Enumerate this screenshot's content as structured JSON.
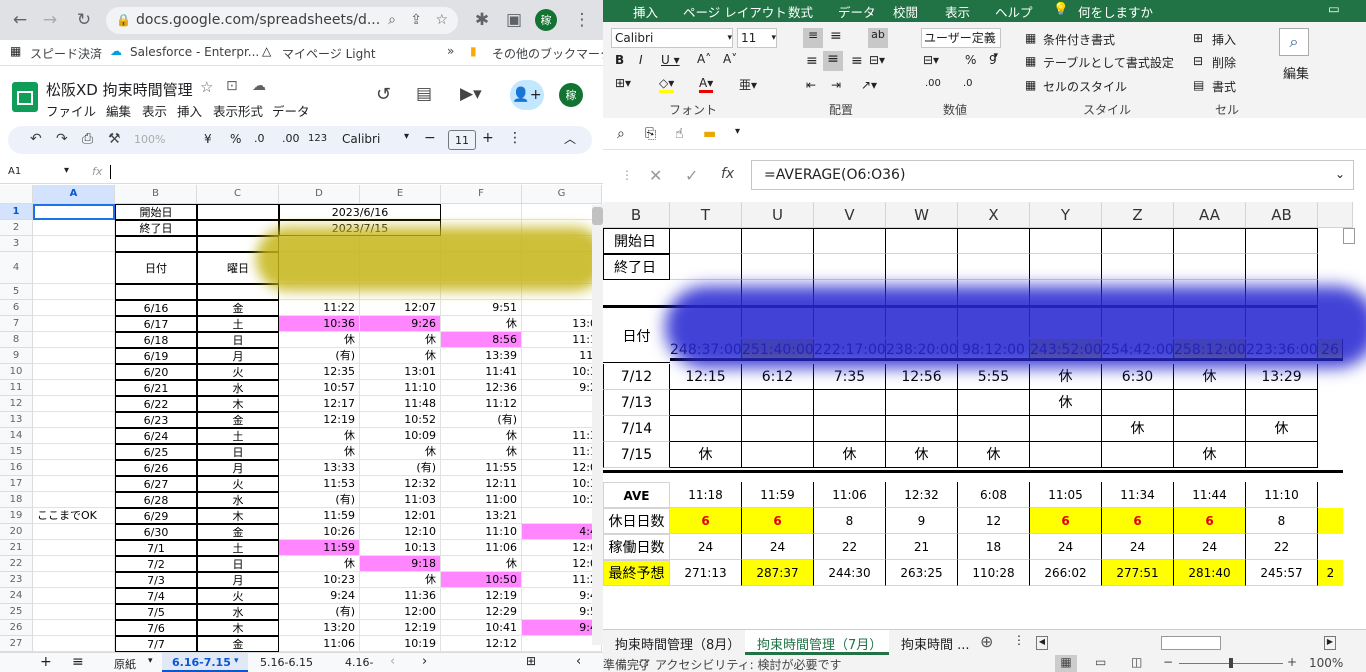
{
  "chrome": {
    "url": "docs.google.com/spreadsheets/d...",
    "avatar": "稼",
    "bookmarks": [
      "スピード決済",
      "Salesforce - Enterpr...",
      "マイページ Light",
      "»",
      "その他のブックマーク"
    ]
  },
  "gs": {
    "title": "松阪XD 拘束時間管理",
    "menu": [
      "ファイル",
      "編集",
      "表示",
      "挿入",
      "表示形式",
      "データ"
    ],
    "avatar": "稼",
    "toolbar": {
      "zoom": "100%",
      "currency": "¥",
      "percent": "%",
      "dec_less": ".0",
      "dec_more": ".00",
      "fmt": "123",
      "font": "Calibri",
      "size": "11"
    },
    "namebox": "A1",
    "fx": "fx",
    "col_headers": [
      "A",
      "B",
      "C",
      "D",
      "E",
      "F",
      "G"
    ],
    "rows": [
      {
        "n": "1",
        "A": "",
        "B": "開始日",
        "C": "",
        "D": "2023/6/16",
        "E": "",
        "F": "",
        "G": ""
      },
      {
        "n": "2",
        "A": "",
        "B": "終了日",
        "C": "",
        "D": "2023/7/15",
        "E": "",
        "F": "",
        "G": ""
      },
      {
        "n": "3",
        "A": "",
        "B": "",
        "C": "",
        "D": "",
        "E": "",
        "F": "",
        "G": ""
      },
      {
        "n": "4",
        "A": "",
        "B": "日付",
        "C": "曜日",
        "D": "",
        "E": "",
        "F": "",
        "G": ""
      },
      {
        "n": "5",
        "A": "",
        "B": "",
        "C": "",
        "D": "",
        "E": "",
        "F": "",
        "G": ""
      },
      {
        "n": "6",
        "A": "",
        "B": "6/16",
        "C": "金",
        "D": "11:22",
        "E": "12:07",
        "F": "9:51",
        "G": "",
        "pk": []
      },
      {
        "n": "7",
        "A": "",
        "B": "6/17",
        "C": "土",
        "D": "10:36",
        "E": "9:26",
        "F": "休",
        "G": "13:0",
        "pk": [
          "D",
          "E"
        ]
      },
      {
        "n": "8",
        "A": "",
        "B": "6/18",
        "C": "日",
        "D": "休",
        "E": "休",
        "F": "8:56",
        "G": "11:1",
        "pk": [
          "F"
        ]
      },
      {
        "n": "9",
        "A": "",
        "B": "6/19",
        "C": "月",
        "D": "(有)",
        "E": "休",
        "F": "13:39",
        "G": "11:",
        "pk": []
      },
      {
        "n": "10",
        "A": "",
        "B": "6/20",
        "C": "火",
        "D": "12:35",
        "E": "13:01",
        "F": "11:41",
        "G": "10:3",
        "pk": []
      },
      {
        "n": "11",
        "A": "",
        "B": "6/21",
        "C": "水",
        "D": "10:57",
        "E": "11:10",
        "F": "12:36",
        "G": "9:2",
        "pk": []
      },
      {
        "n": "12",
        "A": "",
        "B": "6/22",
        "C": "木",
        "D": "12:17",
        "E": "11:48",
        "F": "11:12",
        "G": "",
        "pk": []
      },
      {
        "n": "13",
        "A": "",
        "B": "6/23",
        "C": "金",
        "D": "12:19",
        "E": "10:52",
        "F": "(有)",
        "G": "",
        "pk": []
      },
      {
        "n": "14",
        "A": "",
        "B": "6/24",
        "C": "土",
        "D": "休",
        "E": "10:09",
        "F": "休",
        "G": "11:3",
        "pk": []
      },
      {
        "n": "15",
        "A": "",
        "B": "6/25",
        "C": "日",
        "D": "休",
        "E": "休",
        "F": "休",
        "G": "11:1",
        "pk": []
      },
      {
        "n": "16",
        "A": "",
        "B": "6/26",
        "C": "月",
        "D": "13:33",
        "E": "(有)",
        "F": "11:55",
        "G": "12:0",
        "pk": []
      },
      {
        "n": "17",
        "A": "",
        "B": "6/27",
        "C": "火",
        "D": "11:53",
        "E": "12:32",
        "F": "12:11",
        "G": "10:3",
        "pk": []
      },
      {
        "n": "18",
        "A": "",
        "B": "6/28",
        "C": "水",
        "D": "(有)",
        "E": "11:03",
        "F": "11:00",
        "G": "10:2",
        "pk": []
      },
      {
        "n": "19",
        "A": "ここまでOK",
        "B": "6/29",
        "C": "木",
        "D": "11:59",
        "E": "12:01",
        "F": "13:21",
        "G": "(",
        "pk": []
      },
      {
        "n": "20",
        "A": "",
        "B": "6/30",
        "C": "金",
        "D": "10:26",
        "E": "12:10",
        "F": "11:10",
        "G": "4:4",
        "pk": [
          "G"
        ]
      },
      {
        "n": "21",
        "A": "",
        "B": "7/1",
        "C": "土",
        "D": "11:59",
        "E": "10:13",
        "F": "11:06",
        "G": "12:0",
        "pk": [
          "D"
        ]
      },
      {
        "n": "22",
        "A": "",
        "B": "7/2",
        "C": "日",
        "D": "休",
        "E": "9:18",
        "F": "休",
        "G": "12:0",
        "pk": [
          "E"
        ]
      },
      {
        "n": "23",
        "A": "",
        "B": "7/3",
        "C": "月",
        "D": "10:23",
        "E": "休",
        "F": "10:50",
        "G": "11:2",
        "pk": [
          "F"
        ]
      },
      {
        "n": "24",
        "A": "",
        "B": "7/4",
        "C": "火",
        "D": "9:24",
        "E": "11:36",
        "F": "12:19",
        "G": "9:4",
        "pk": []
      },
      {
        "n": "25",
        "A": "",
        "B": "7/5",
        "C": "水",
        "D": "(有)",
        "E": "12:00",
        "F": "12:29",
        "G": "9:5",
        "pk": []
      },
      {
        "n": "26",
        "A": "",
        "B": "7/6",
        "C": "木",
        "D": "13:20",
        "E": "12:19",
        "F": "10:41",
        "G": "9:4",
        "pk": [
          "G"
        ]
      },
      {
        "n": "27",
        "A": "",
        "B": "7/7",
        "C": "金",
        "D": "11:06",
        "E": "10:19",
        "F": "12:12",
        "G": "",
        "pk": []
      }
    ],
    "sheet_tabs": [
      "原紙",
      "6.16-7.15",
      "5.16-6.15",
      "4.16-"
    ]
  },
  "xl": {
    "tabs": [
      "挿入",
      "ページ レイアウト",
      "数式",
      "データ",
      "校閲",
      "表示",
      "ヘルプ",
      "何をしますか"
    ],
    "font": "Calibri",
    "size": "11",
    "number_format": "ユーザー定義",
    "cond_fmt": "条件付き書式",
    "table_fmt": "テーブルとして書式設定",
    "cell_style": "セルのスタイル",
    "insert": "挿入",
    "delete": "削除",
    "format": "書式",
    "edit": "編集",
    "groups": [
      "フォント",
      "配置",
      "数値",
      "スタイル",
      "セル"
    ],
    "formula": "=AVERAGE(O6:O36)",
    "fx": "fx",
    "col_headers": [
      "B",
      "T",
      "U",
      "V",
      "W",
      "X",
      "Y",
      "Z",
      "AA",
      "AB"
    ],
    "labels": {
      "start": "開始日",
      "end": "終了日",
      "date": "日付",
      "ave": "AVE",
      "rest": "休日日数",
      "work": "稼働日数",
      "forecast": "最終予想"
    },
    "totals": [
      "248:37:00",
      "251:40:00",
      "222:17:00",
      "238:20:00",
      "98:12:00",
      "243:52:00",
      "254:42:00",
      "258:12:00",
      "223:36:00",
      "26"
    ],
    "date_rows": [
      {
        "d": "7/12",
        "v": [
          "12:15",
          "6:12",
          "7:35",
          "12:56",
          "5:55",
          "休",
          "6:30",
          "休",
          "13:29"
        ]
      },
      {
        "d": "7/13",
        "v": [
          "",
          "",
          "",
          "",
          "",
          "休",
          "",
          "",
          ""
        ]
      },
      {
        "d": "7/14",
        "v": [
          "",
          "",
          "",
          "",
          "",
          "",
          "休",
          "",
          "休"
        ]
      },
      {
        "d": "7/15",
        "v": [
          "休",
          "",
          "休",
          "休",
          "休",
          "",
          "",
          "休",
          ""
        ]
      }
    ],
    "ave": [
      "11:18",
      "11:59",
      "11:06",
      "12:32",
      "6:08",
      "11:05",
      "11:34",
      "11:44",
      "11:10"
    ],
    "rest": [
      "6",
      "6",
      "8",
      "9",
      "12",
      "6",
      "6",
      "6",
      "8"
    ],
    "work": [
      "24",
      "24",
      "22",
      "21",
      "18",
      "24",
      "24",
      "24",
      "22"
    ],
    "forecast": [
      "271:13",
      "287:37",
      "244:30",
      "263:25",
      "110:28",
      "266:02",
      "277:51",
      "281:40",
      "245:57",
      "2"
    ],
    "sheet_tabs": [
      "拘束時間管理（8月）",
      "拘束時間管理（7月）",
      "拘束時間 ..."
    ],
    "status": "アクセシビリティ: 検討が必要です",
    "status_left": "準備完了",
    "zoom": "100%"
  }
}
